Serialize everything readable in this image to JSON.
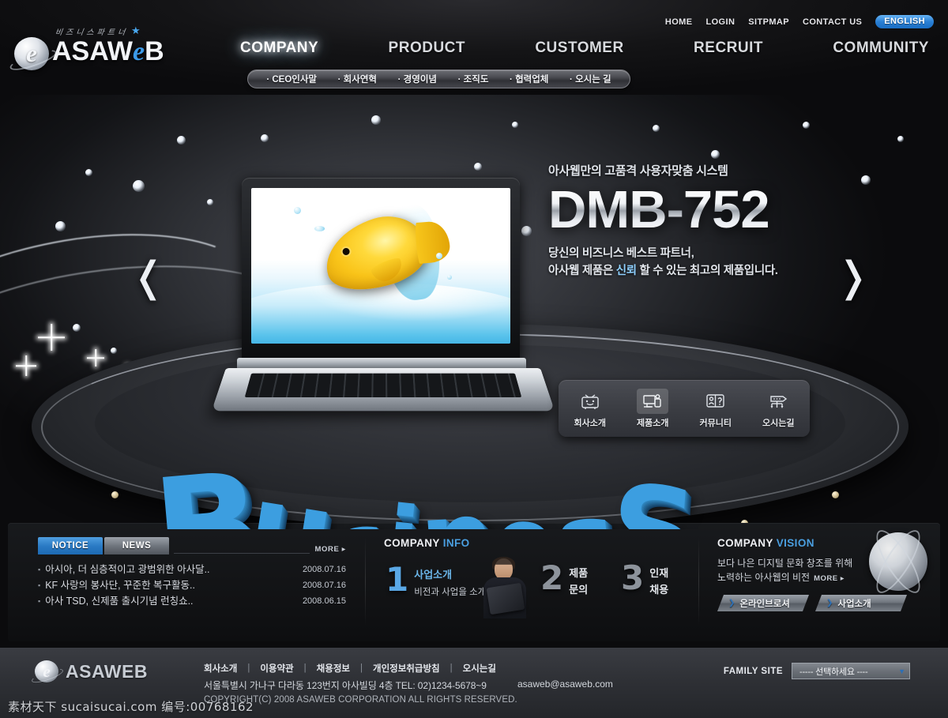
{
  "header": {
    "util_nav": [
      {
        "label": "HOME",
        "name": "home"
      },
      {
        "label": "LOGIN",
        "name": "login"
      },
      {
        "label": "SITPMAP",
        "name": "sitemap"
      },
      {
        "label": "CONTACT US",
        "name": "contact-us"
      }
    ],
    "language_pill": "ENGLISH",
    "logo": {
      "tagline": "비즈니스파트너",
      "word_a": "ASAW",
      "word_e": "e",
      "word_b": "B",
      "star": "★"
    },
    "main_nav": [
      {
        "label": "COMPANY",
        "name": "company",
        "active": true
      },
      {
        "label": "PRODUCT",
        "name": "product",
        "active": false
      },
      {
        "label": "CUSTOMER",
        "name": "customer",
        "active": false
      },
      {
        "label": "RECRUIT",
        "name": "recruit",
        "active": false
      },
      {
        "label": "COMMUNITY",
        "name": "community",
        "active": false
      }
    ],
    "sub_nav": [
      "· CEO인사말",
      "· 회사연혁",
      "· 경영이념",
      "· 조직도",
      "· 협력업체",
      "· 오시는 길"
    ]
  },
  "hero": {
    "kicker": "아사웹만의 고품격 사용자맞춤 시스템",
    "title": "DMB-752",
    "sub_line1": "당신의 비즈니스 베스트 파트너,",
    "sub_line2_a": "아사웹 제품은 ",
    "sub_line2_hl": "신뢰",
    "sub_line2_b": " 할 수 있는 최고의 제품입니다.",
    "prev_arrow": "❬",
    "next_arrow": "❭",
    "stage_word": [
      "B",
      "u",
      "s",
      "i",
      "n",
      "e",
      "s",
      "S"
    ],
    "quick_links": [
      {
        "label": "회사소개",
        "icon": "tv-icon",
        "active": false
      },
      {
        "label": "제품소개",
        "icon": "monitor-icon",
        "active": true
      },
      {
        "label": "커뮤니티",
        "icon": "chat-icon",
        "active": false
      },
      {
        "label": "오시는길",
        "icon": "map-route-icon",
        "active": false
      }
    ]
  },
  "notice": {
    "tabs": [
      {
        "label": "NOTICE",
        "active": true
      },
      {
        "label": "NEWS",
        "active": false
      }
    ],
    "more": "MORE ▸",
    "items": [
      {
        "bullet": "▪",
        "title": "아시아, 더 심층적이고 광범위한 아사달..",
        "date": "2008.07.16"
      },
      {
        "bullet": "▪",
        "title": "KF 사랑의 봉사단, 꾸준한 복구활동..",
        "date": "2008.07.16"
      },
      {
        "bullet": "▪",
        "title": "아사 TSD, 신제품 출시기념 런칭쇼..",
        "date": "2008.06.15"
      }
    ]
  },
  "company_info": {
    "title_main": "COMPANY ",
    "title_accent": "INFO",
    "steps": [
      {
        "num": "1",
        "head": "사업소개",
        "sub": "비전과 사업을 소개",
        "line2": ""
      },
      {
        "num": "2",
        "head": "제품",
        "sub": "",
        "line2": "문의"
      },
      {
        "num": "3",
        "head": "인재",
        "sub": "",
        "line2": "채용"
      }
    ]
  },
  "company_vision": {
    "title_main": "COMPANY ",
    "title_accent": "VISION",
    "line1": "보다 나은 디지털 문화 창조를 위해",
    "line2": "노력하는 아사웹의 비전",
    "more": "MORE ▸",
    "buttons": [
      {
        "label": "온라인브로셔",
        "chev": "❯"
      },
      {
        "label": "사업소개",
        "chev": "❯"
      }
    ]
  },
  "footer": {
    "logo_e": "e",
    "logo_word": "ASAWEB",
    "links": [
      "회사소개",
      "이용약관",
      "채용정보",
      "개인정보취급방침",
      "오시는길"
    ],
    "separator": "|",
    "address": "서울특별시 가나구 다라동 123번지 아사빌딩 4층 TEL: 02)1234-5678~9",
    "email": "asaweb@asaweb.com",
    "copyright": "COPYRIGHT(C) 2008 ASAWEB CORPORATION ALL RIGHTS RESERVED.",
    "family_label": "FAMILY SITE",
    "family_value": "----- 선택하세요 ----",
    "family_arrow": "▼"
  },
  "watermark": "素材天下 sucaisucai.com 编号:00768162",
  "colors": {
    "accent_blue": "#4a9fe0",
    "pill_blue": "#2a7fd4",
    "biz_blue": "#3c9ee0",
    "panel_dark": "#121315",
    "footer_gray": "#2e3035"
  }
}
